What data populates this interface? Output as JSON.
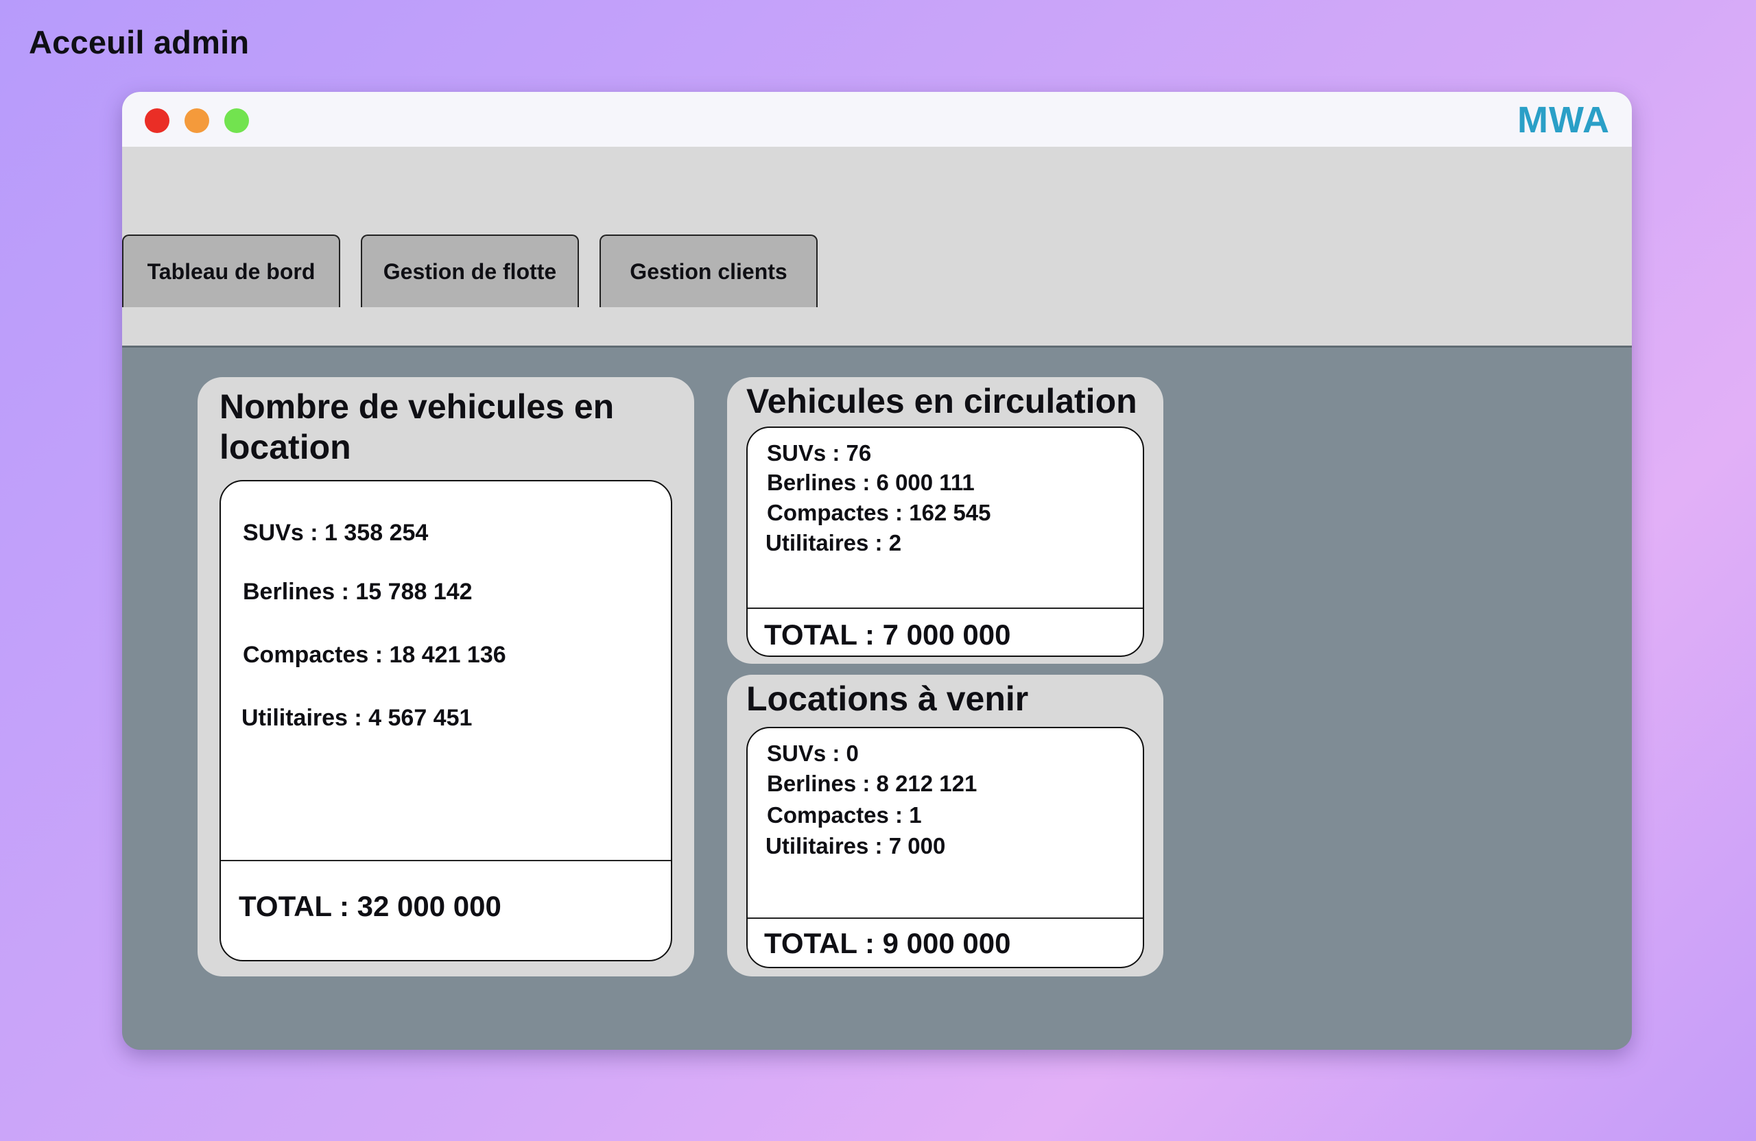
{
  "page": {
    "title": "Acceuil admin"
  },
  "window": {
    "brand": "MWA",
    "brand_color": "#2a9fc7"
  },
  "tabs": [
    {
      "label": "Tableau de bord"
    },
    {
      "label": "Gestion de flotte"
    },
    {
      "label": "Gestion clients"
    }
  ],
  "cards": [
    {
      "title": "Nombre de vehicules en location",
      "rows": [
        "SUVs : 1 358 254",
        "Berlines : 15 788 142",
        "Compactes : 18 421 136",
        "Utilitaires : 4 567 451"
      ],
      "total": "TOTAL : 32 000 000"
    },
    {
      "title": "Vehicules en circulation",
      "rows": [
        "SUVs : 76",
        "Berlines : 6 000 111",
        "Compactes : 162 545",
        "Utilitaires : 2"
      ],
      "total": "TOTAL : 7 000 000"
    },
    {
      "title": "Locations à venir",
      "rows": [
        "SUVs : 0",
        "Berlines : 8 212 121",
        "Compactes : 1",
        "Utilitaires : 7 000"
      ],
      "total": "TOTAL : 9 000 000"
    }
  ]
}
